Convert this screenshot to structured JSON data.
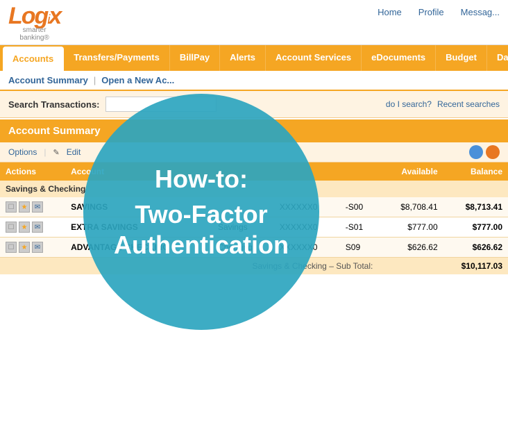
{
  "topBar": {
    "logo": {
      "brand": "Log",
      "brand2": "ix",
      "tagline1": "smarter",
      "tagline2": "banking"
    },
    "nav": {
      "home": "Home",
      "profile": "Profile",
      "messages": "Messag..."
    }
  },
  "mainNav": {
    "items": [
      {
        "label": "Accounts",
        "active": true
      },
      {
        "label": "Transfers/Payments",
        "active": false
      },
      {
        "label": "BillPay",
        "active": false
      },
      {
        "label": "Alerts",
        "active": false
      },
      {
        "label": "Account Services",
        "active": false
      },
      {
        "label": "eDocuments",
        "active": false
      },
      {
        "label": "Budget",
        "active": false
      },
      {
        "label": "Da...",
        "active": false
      }
    ]
  },
  "breadcrumb": {
    "current": "Account Summary",
    "divider": "|",
    "next": "Open a New Ac..."
  },
  "search": {
    "label": "Search Transactions:",
    "placeholder": "",
    "helpLink": "do I search?",
    "recentLink": "Recent searches"
  },
  "accountSummary": {
    "title": "Account Summary",
    "toolbar": {
      "options": "Options",
      "edit": "Edit"
    },
    "tableHeaders": [
      {
        "label": "Actions",
        "align": "left"
      },
      {
        "label": "Account",
        "align": "left"
      },
      {
        "label": "",
        "align": "left"
      },
      {
        "label": "",
        "align": "left"
      },
      {
        "label": "",
        "align": "left"
      },
      {
        "label": "Available",
        "align": "right"
      },
      {
        "label": "Balance",
        "align": "right"
      }
    ],
    "sections": [
      {
        "name": "Savings & Checking",
        "rows": [
          {
            "name": "SAVINGS",
            "type": "",
            "accountNum": "XXXXXX0",
            "suffix": "-S00",
            "available": "$8,708.41",
            "balance": "$8,713.41"
          },
          {
            "name": "EXTRA SAVINGS",
            "type": "Savings",
            "accountNum": "XXXXXX0",
            "suffix": "-S01",
            "available": "$777.00",
            "balance": "$777.00"
          },
          {
            "name": "ADVANTAGE CHECKING",
            "type": "Checking",
            "accountNum": "XXXXXX0",
            "suffix": "S09",
            "available": "$626.62",
            "balance": "$626.62"
          }
        ],
        "subtotalLabel": "Savings & Checking – Sub Total:",
        "subtotalValue": "$10,117.03"
      }
    ]
  },
  "overlay": {
    "title": "How-to:",
    "subtitle1": "Two-Factor",
    "subtitle2": "Authentication"
  }
}
